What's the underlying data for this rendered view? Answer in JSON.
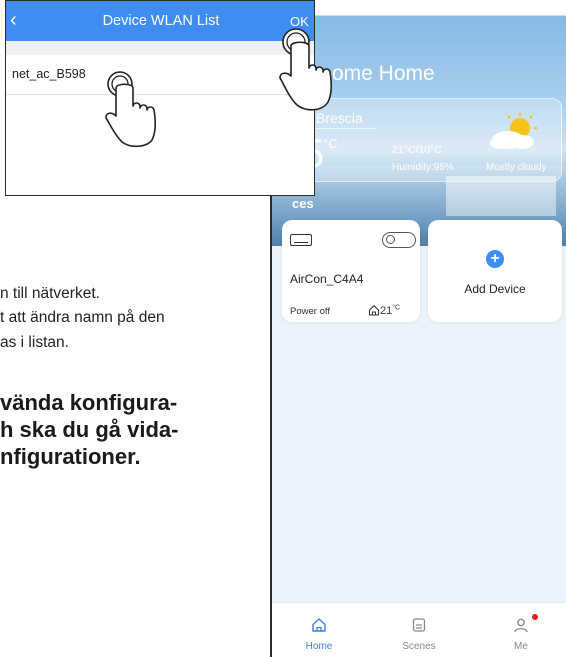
{
  "manual": {
    "line1": "n till nätverket.",
    "line2": "t att ändra namn på den",
    "line3": "as i listan.",
    "bold1": "vända  konfigura-",
    "bold2": "h ska du gå vida-",
    "bold3": "nfigurationer."
  },
  "dialog": {
    "back_icon": "‹",
    "title": "Device WLAN List",
    "ok_label": "OK",
    "items": [
      {
        "name": "net_ac_B598"
      }
    ]
  },
  "app": {
    "home_title": "ome Home",
    "weather": {
      "city": "Brescia",
      "temp": "5",
      "unit": "°C",
      "range": "21°C/10°C",
      "humidity": "Humidity:95%",
      "description": "Mostly cloudy"
    },
    "devices_label": "ces",
    "device_card": {
      "name": "AirCon_C4A4",
      "status": "Power off",
      "temp": "21",
      "temp_unit": "°C"
    },
    "add_device": {
      "plus": "+",
      "label": "Add Device"
    },
    "tabs": [
      {
        "label": "Home",
        "icon": "home-icon"
      },
      {
        "label": "Scenes",
        "icon": "scenes-icon"
      },
      {
        "label": "Me",
        "icon": "person-icon"
      }
    ],
    "colors": {
      "accent": "#3f8df0",
      "active_tab": "#3f7fd8",
      "notification_dot": "#e02020"
    }
  }
}
